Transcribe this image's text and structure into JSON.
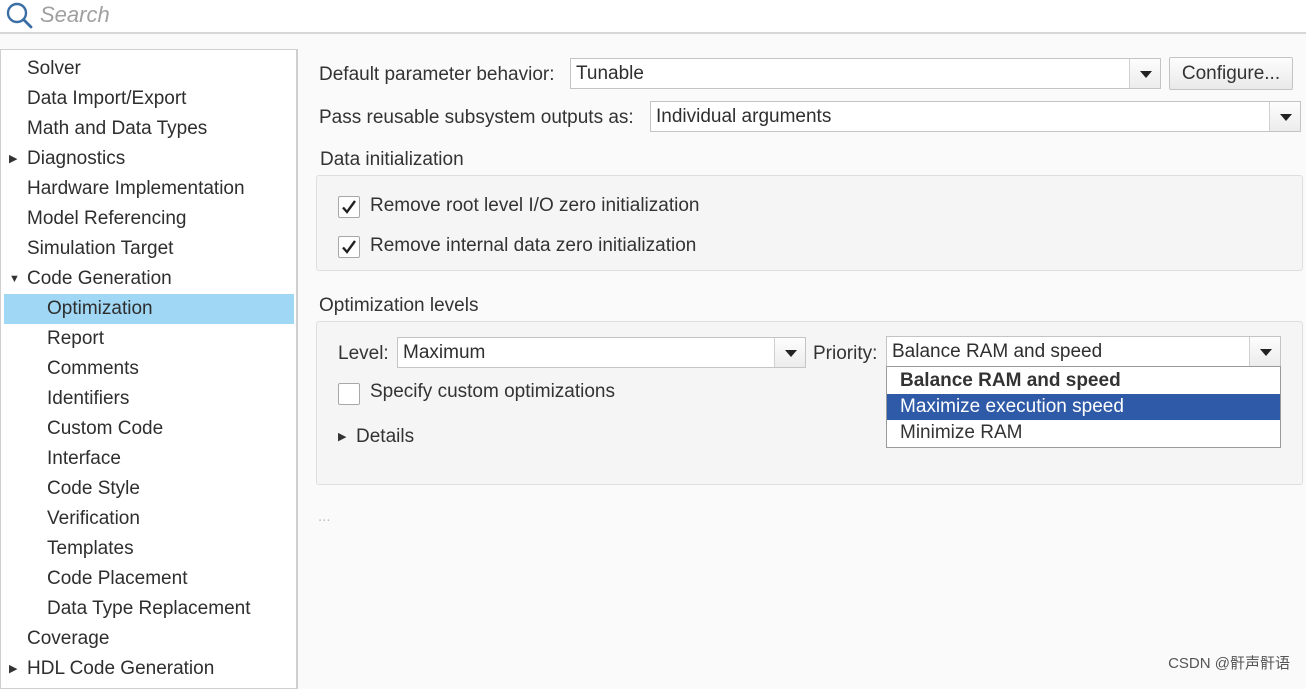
{
  "search": {
    "placeholder": "Search"
  },
  "sidebar": {
    "items": [
      {
        "label": "Solver"
      },
      {
        "label": "Data Import/Export"
      },
      {
        "label": "Math and Data Types"
      },
      {
        "label": "Diagnostics"
      },
      {
        "label": "Hardware Implementation"
      },
      {
        "label": "Model Referencing"
      },
      {
        "label": "Simulation Target"
      },
      {
        "label": "Code Generation"
      },
      {
        "label": "Optimization"
      },
      {
        "label": "Report"
      },
      {
        "label": "Comments"
      },
      {
        "label": "Identifiers"
      },
      {
        "label": "Custom Code"
      },
      {
        "label": "Interface"
      },
      {
        "label": "Code Style"
      },
      {
        "label": "Verification"
      },
      {
        "label": "Templates"
      },
      {
        "label": "Code Placement"
      },
      {
        "label": "Data Type Replacement"
      },
      {
        "label": "Coverage"
      },
      {
        "label": "HDL Code Generation"
      }
    ]
  },
  "main": {
    "default_param_label": "Default parameter behavior:",
    "default_param_value": "Tunable",
    "configure_label": "Configure...",
    "pass_reusable_label": "Pass reusable subsystem outputs as:",
    "pass_reusable_value": "Individual arguments",
    "data_init_heading": "Data initialization",
    "remove_root_label": "Remove root level I/O zero initialization",
    "remove_internal_label": "Remove internal data zero initialization",
    "opt_levels_heading": "Optimization levels",
    "level_label": "Level:",
    "level_value": "Maximum",
    "priority_label": "Priority:",
    "priority_value": "Balance RAM and speed",
    "priority_options": [
      {
        "label": "Balance RAM and speed"
      },
      {
        "label": "Maximize execution speed"
      },
      {
        "label": "Minimize RAM"
      }
    ],
    "custom_opt_label": "Specify custom optimizations",
    "details_label": "Details",
    "ellipsis": "..."
  },
  "watermark": "CSDN @骭声骭语",
  "colors": {
    "selection": "#9fd7f5",
    "highlight": "#2f5aa8"
  }
}
